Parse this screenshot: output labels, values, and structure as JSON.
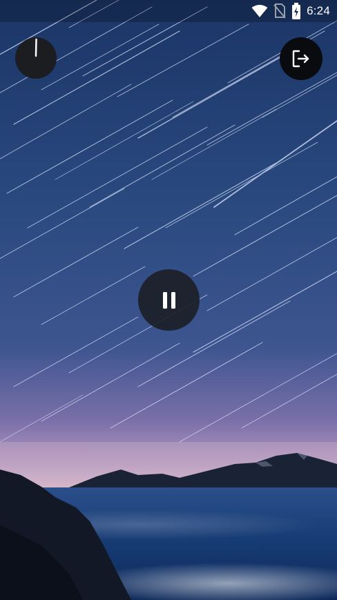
{
  "status_bar": {
    "time": "6:24",
    "icons": [
      "wifi-icon",
      "no-sim-icon",
      "battery-charging-icon"
    ]
  },
  "controls": {
    "timer_icon": "timer-icon",
    "exit_icon": "exit-icon",
    "play_state_icon": "pause-icon"
  },
  "background": {
    "scene": "star-trails-over-mountains-and-lake",
    "sky_top": "#1e3a6c",
    "sky_horizon": "#b89ac0",
    "water": "#1b3f78",
    "mountains": "#141c2e"
  }
}
